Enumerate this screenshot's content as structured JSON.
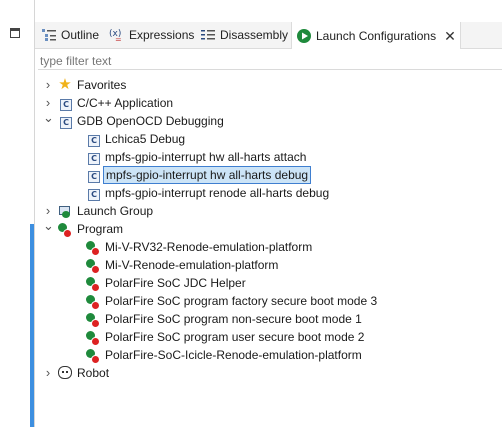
{
  "tabs": [
    {
      "label": "Outline",
      "icon": "outline-icon"
    },
    {
      "label": "Expressions",
      "icon": "expressions-icon"
    },
    {
      "label": "Disassembly",
      "icon": "disassembly-icon"
    },
    {
      "label": "Launch Configurations",
      "icon": "launch-config-icon",
      "active": true
    }
  ],
  "filter": {
    "placeholder": "type filter text",
    "value": ""
  },
  "tree": [
    {
      "label": "Favorites",
      "twisty": "collapsed",
      "icon": "star-icon",
      "level": 0
    },
    {
      "label": "C/C++ Application",
      "twisty": "collapsed",
      "icon": "c-config-icon",
      "level": 0
    },
    {
      "label": "GDB OpenOCD Debugging",
      "twisty": "expanded",
      "icon": "c-config-icon",
      "level": 0
    },
    {
      "label": "Lchica5 Debug",
      "icon": "c-config-icon",
      "level": 1
    },
    {
      "label": "mpfs-gpio-interrupt hw all-harts attach",
      "icon": "c-config-icon",
      "level": 1
    },
    {
      "label": "mpfs-gpio-interrupt hw all-harts debug",
      "icon": "c-config-icon",
      "level": 1,
      "selected": true
    },
    {
      "label": "mpfs-gpio-interrupt renode all-harts debug",
      "icon": "c-config-icon",
      "level": 1
    },
    {
      "label": "Launch Group",
      "twisty": "collapsed",
      "icon": "launch-group-icon",
      "level": 0
    },
    {
      "label": "Program",
      "twisty": "expanded",
      "icon": "program-icon",
      "level": 0
    },
    {
      "label": "Mi-V-RV32-Renode-emulation-platform",
      "icon": "program-icon",
      "level": 1
    },
    {
      "label": "Mi-V-Renode-emulation-platform",
      "icon": "program-icon",
      "level": 1
    },
    {
      "label": "PolarFire SoC JDC Helper",
      "icon": "program-icon",
      "level": 1
    },
    {
      "label": "PolarFire SoC program factory secure boot mode 3",
      "icon": "program-icon",
      "level": 1
    },
    {
      "label": "PolarFire SoC program non-secure boot mode 1",
      "icon": "program-icon",
      "level": 1
    },
    {
      "label": "PolarFire SoC program user secure boot mode 2",
      "icon": "program-icon",
      "level": 1
    },
    {
      "label": "PolarFire-SoC-Icicle-Renode-emulation-platform",
      "icon": "program-icon",
      "level": 1
    },
    {
      "label": "Robot",
      "twisty": "collapsed",
      "icon": "robot-icon",
      "level": 0
    }
  ],
  "colors": {
    "selection": "#cce4f7",
    "selection_border": "#3f7fd0",
    "scrollbar": "#3d8fe0"
  }
}
